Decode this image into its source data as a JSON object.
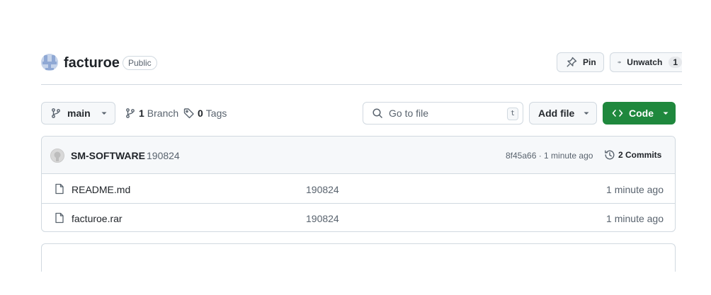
{
  "repo": {
    "name": "facturoe",
    "visibility": "Public",
    "actions": {
      "pin_label": "Pin",
      "unwatch_label": "Unwatch",
      "watch_count": "1"
    }
  },
  "toolbar": {
    "branch": "main",
    "branches_count": "1",
    "branches_label": "Branch",
    "tags_count": "0",
    "tags_label": "Tags",
    "search_placeholder": "Go to file",
    "search_shortcut": "t",
    "add_file_label": "Add file",
    "code_label": "Code",
    "code_color": "#1f883d"
  },
  "latest_commit": {
    "author": "SM-SOFTWARE",
    "message": "190824",
    "hash_time": "8f45a66 · 1 minute ago",
    "commits_label": "2 Commits"
  },
  "files": [
    {
      "name": "README.md",
      "commit_message": "190824",
      "time": "1 minute ago",
      "icon": "file-icon"
    },
    {
      "name": "facturoe.rar",
      "commit_message": "190824",
      "time": "1 minute ago",
      "icon": "file-icon"
    }
  ]
}
